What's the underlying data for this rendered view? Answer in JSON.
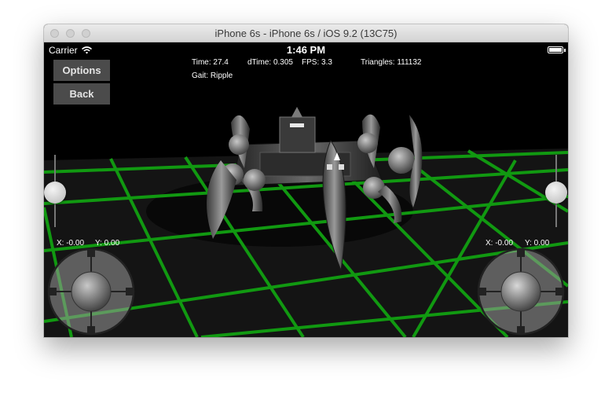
{
  "window": {
    "title": "iPhone 6s - iPhone 6s / iOS 9.2 (13C75)"
  },
  "status_bar": {
    "carrier": "Carrier",
    "time": "1:46 PM"
  },
  "stats": {
    "time": "Time: 27.4",
    "dtime": "dTime: 0.305",
    "fps": "FPS: 3.3",
    "triangles": "Triangles: 111132",
    "gait": "Gait: Ripple"
  },
  "buttons": {
    "options": "Options",
    "back": "Back"
  },
  "joysticks": {
    "left": {
      "x": "X: -0.00",
      "y": "Y: 0.00"
    },
    "right": {
      "x": "X: -0.00",
      "y": "Y: 0.00"
    }
  },
  "colors": {
    "grid": "#119911",
    "floor": "#141414",
    "button": "#4b4b4b"
  }
}
